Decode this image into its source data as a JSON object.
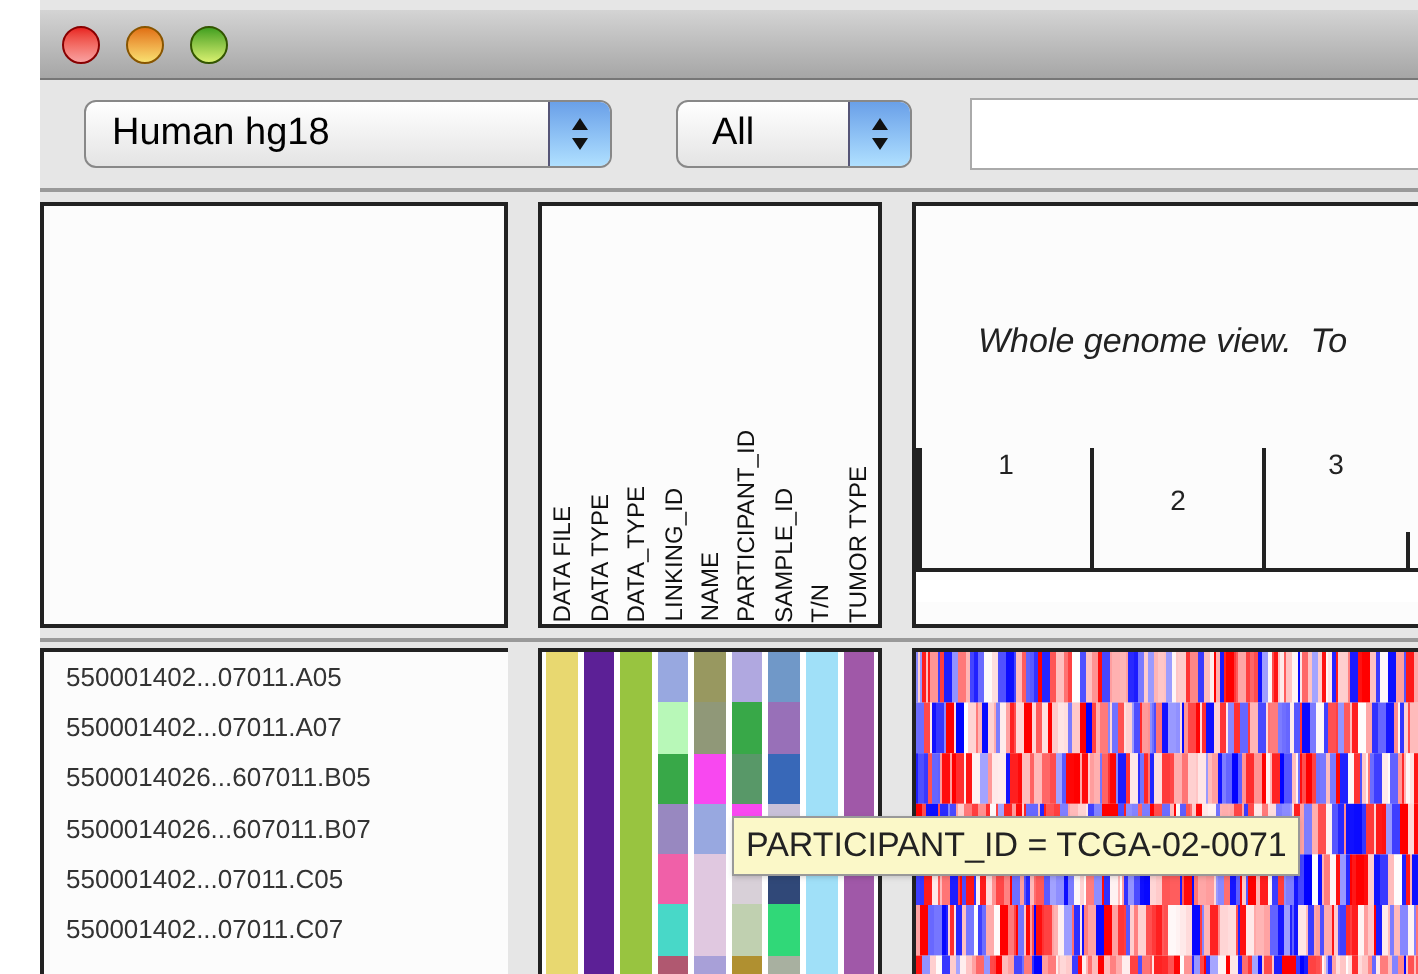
{
  "toolbar": {
    "genome": "Human hg18",
    "chromosome": "All"
  },
  "attribute_headers": [
    "DATA FILE",
    "DATA TYPE",
    "DATA_TYPE",
    "LINKING_ID",
    "NAME",
    "PARTICIPANT_ID",
    "SAMPLE_ID",
    "T/N",
    "TUMOR TYPE"
  ],
  "ruler": {
    "message": "Whole genome view.  To",
    "chromosomes": [
      "1",
      "2",
      "3"
    ]
  },
  "samples": [
    {
      "name": "550001402...07011.A05",
      "attributes": [
        {
          "color": "#e8d870"
        },
        {
          "color": "#5c2096"
        },
        {
          "color": "#98c440"
        },
        {
          "color": "#98a8e0"
        },
        {
          "color": "#989860"
        },
        {
          "color": "#b0a8e0"
        },
        {
          "color": "#7098c8"
        },
        {
          "color": "#a0e0f8"
        },
        {
          "color": "#a058a8"
        }
      ]
    },
    {
      "name": "550001402...07011.A07",
      "attributes": [
        {
          "color": "#e8d870"
        },
        {
          "color": "#5c2096"
        },
        {
          "color": "#98c440"
        },
        {
          "color": "#b8f8b8"
        },
        {
          "color": "#909878"
        },
        {
          "color": "#38a848"
        },
        {
          "color": "#9870b8"
        },
        {
          "color": "#a0e0f8"
        },
        {
          "color": "#a058a8"
        }
      ]
    },
    {
      "name": "5500014026...607011.B05",
      "attributes": [
        {
          "color": "#e8d870"
        },
        {
          "color": "#5c2096"
        },
        {
          "color": "#98c440"
        },
        {
          "color": "#38a848"
        },
        {
          "color": "#f848f0"
        },
        {
          "color": "#589868"
        },
        {
          "color": "#3868b8"
        },
        {
          "color": "#a0e0f8"
        },
        {
          "color": "#a058a8"
        }
      ]
    },
    {
      "name": "5500014026...607011.B07",
      "attributes": [
        {
          "color": "#e8d870"
        },
        {
          "color": "#5c2096"
        },
        {
          "color": "#98c440"
        },
        {
          "color": "#9888c0"
        },
        {
          "color": "#98a8e0"
        },
        {
          "color": "#f848f0"
        },
        {
          "color": "#c8c0d8"
        },
        {
          "color": "#a0e0f8"
        },
        {
          "color": "#a058a8"
        }
      ]
    },
    {
      "name": "550001402...07011.C05",
      "attributes": [
        {
          "color": "#e8d870"
        },
        {
          "color": "#5c2096"
        },
        {
          "color": "#98c440"
        },
        {
          "color": "#f060a8"
        },
        {
          "color": "#e0c8e0"
        },
        {
          "color": "#d8d0d8"
        },
        {
          "color": "#304878"
        },
        {
          "color": "#a0e0f8"
        },
        {
          "color": "#a058a8"
        }
      ]
    },
    {
      "name": "550001402...07011.C07",
      "attributes": [
        {
          "color": "#e8d870"
        },
        {
          "color": "#5c2096"
        },
        {
          "color": "#98c440"
        },
        {
          "color": "#48d8c8"
        },
        {
          "color": "#e0c8e0"
        },
        {
          "color": "#c0d0b0"
        },
        {
          "color": "#30d878"
        },
        {
          "color": "#a0e0f8"
        },
        {
          "color": "#a058a8"
        }
      ]
    },
    {
      "attributes": [
        {
          "color": "#e8d870"
        },
        {
          "color": "#5c2096"
        },
        {
          "color": "#98c440"
        },
        {
          "color": "#b05870"
        },
        {
          "color": "#a8a0d8"
        },
        {
          "color": "#b09030"
        },
        {
          "color": "#a8b0a0"
        },
        {
          "color": "#a0e0f8"
        },
        {
          "color": "#a058a8"
        }
      ]
    }
  ],
  "tooltip": "PARTICIPANT_ID = TCGA-02-0071"
}
